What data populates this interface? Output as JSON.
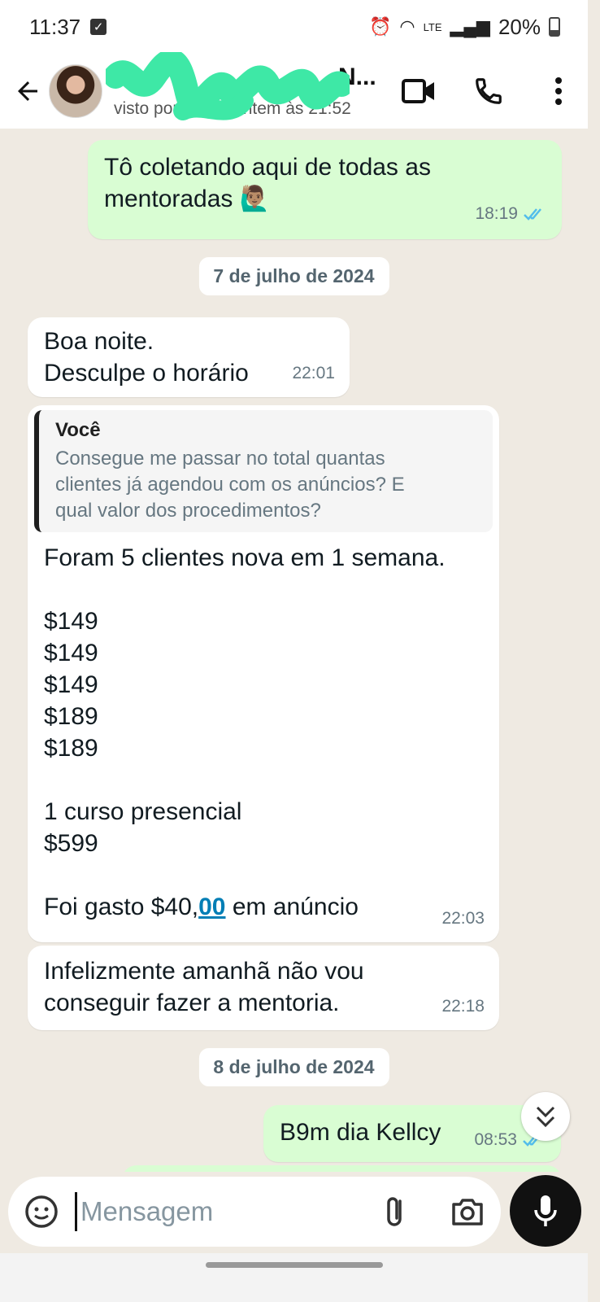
{
  "status_bar": {
    "time": "11:37",
    "battery": "20%",
    "network": "LTE"
  },
  "header": {
    "contact_name": "N...",
    "last_seen": "visto por último ontem às 21:52"
  },
  "messages": [
    {
      "type": "out",
      "lines": [
        "Tô coletando aqui de todas as",
        "mentoradas 🙋🏽‍♂️"
      ],
      "time": "18:19",
      "read": true
    },
    {
      "type": "date",
      "label": "7 de julho de 2024"
    },
    {
      "type": "in",
      "lines": [
        "Boa noite.",
        "Desculpe o horário"
      ],
      "time": "22:01"
    },
    {
      "type": "in",
      "quote_author": "Você",
      "quote_lines": [
        "Consegue me passar no total quantas",
        "clientes já agendou com os anúncios? E",
        "qual valor dos procedimentos?"
      ],
      "lines": [
        "Foram 5 clientes nova em 1 semana.",
        "",
        "$149",
        "$149",
        "$149",
        "$189",
        "$189",
        "",
        "1 curso presencial",
        "$599",
        ""
      ],
      "last_line_prefix": "Foi gasto $40,",
      "last_line_link": "00",
      "last_line_suffix": " em anúncio",
      "time": "22:03"
    },
    {
      "type": "in",
      "lines": [
        "Infelizmente amanhã não vou",
        "conseguir fazer a mentoria."
      ],
      "time": "22:18"
    },
    {
      "type": "date",
      "label": "8 de julho de 2024"
    },
    {
      "type": "out",
      "lines": [
        "B9m dia Kellcy"
      ],
      "time": "08:53",
      "read": true
    }
  ],
  "input": {
    "placeholder": "Mensagem"
  },
  "colors": {
    "outgoing_bubble": "#d9fdd3",
    "incoming_bubble": "#ffffff",
    "chat_background": "#efeae2",
    "read_ticks": "#53bdeb",
    "link": "#027eb5"
  },
  "icons": [
    "back-arrow-icon",
    "video-call-icon",
    "phone-icon",
    "more-options-icon",
    "sticker-icon",
    "attach-icon",
    "camera-icon",
    "mic-icon",
    "scroll-down-icon"
  ]
}
